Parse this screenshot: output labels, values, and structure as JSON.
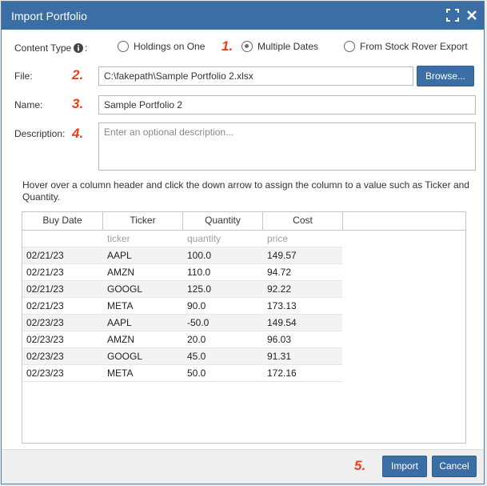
{
  "dialog": {
    "title": "Import Portfolio"
  },
  "content_type": {
    "label": "Content Type",
    "suffix": ":",
    "options": [
      {
        "label": "Holdings on One",
        "checked": false
      },
      {
        "label": "Multiple Dates",
        "checked": true
      },
      {
        "label": "From Stock Rover Export",
        "checked": false
      }
    ]
  },
  "file": {
    "label": "File:",
    "value": "C:\\fakepath\\Sample Portfolio 2.xlsx",
    "browse_label": "Browse..."
  },
  "name": {
    "label": "Name:",
    "value": "Sample Portfolio 2"
  },
  "description": {
    "label": "Description:",
    "placeholder": "Enter an optional description..."
  },
  "step_markers": [
    "1.",
    "2.",
    "3.",
    "4.",
    "5."
  ],
  "hint": "Hover over a column header and click the down arrow to assign the column to a value such as Ticker and Quantity.",
  "grid": {
    "headers": [
      "Buy Date",
      "Ticker",
      "Quantity",
      "Cost"
    ],
    "mapping_row": [
      "",
      "ticker",
      "quantity",
      "price"
    ],
    "rows": [
      [
        "02/21/23",
        "AAPL",
        "100.0",
        "149.57"
      ],
      [
        "02/21/23",
        "AMZN",
        "110.0",
        "94.72"
      ],
      [
        "02/21/23",
        "GOOGL",
        "125.0",
        "92.22"
      ],
      [
        "02/21/23",
        "META",
        "90.0",
        "173.13"
      ],
      [
        "02/23/23",
        "AAPL",
        "-50.0",
        "149.54"
      ],
      [
        "02/23/23",
        "AMZN",
        "20.0",
        "96.03"
      ],
      [
        "02/23/23",
        "GOOGL",
        "45.0",
        "91.31"
      ],
      [
        "02/23/23",
        "META",
        "50.0",
        "172.16"
      ]
    ]
  },
  "buttons": {
    "import": "Import",
    "cancel": "Cancel"
  },
  "colors": {
    "titlebar": "#3a6ea5",
    "button": "#3a6ea5",
    "step_marker": "#e8401c"
  },
  "icons": [
    "maximize-icon",
    "close-icon",
    "info-icon"
  ]
}
